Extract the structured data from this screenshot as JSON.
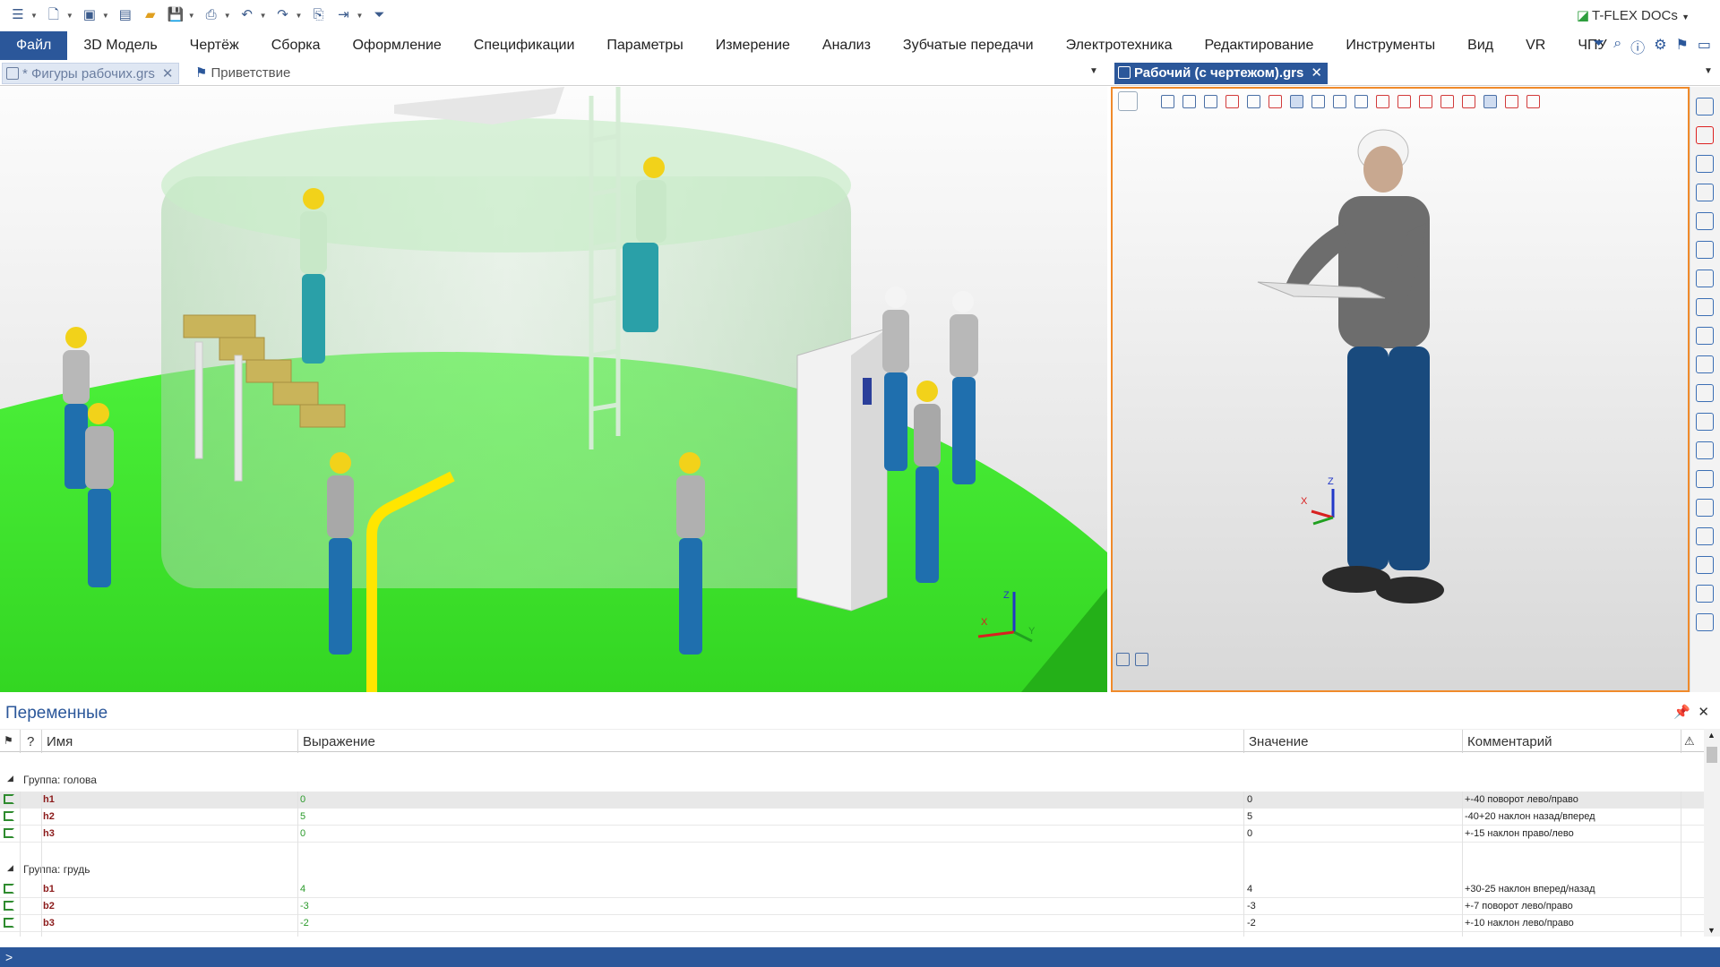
{
  "brand": "T-FLEX DOCs",
  "menu": {
    "file": "Файл",
    "items": [
      "3D Модель",
      "Чертёж",
      "Сборка",
      "Оформление",
      "Спецификации",
      "Параметры",
      "Измерение",
      "Анализ",
      "Зубчатые передачи",
      "Электротехника",
      "Редактирование",
      "Инструменты",
      "Вид",
      "VR",
      "ЧПУ"
    ]
  },
  "tabs": {
    "left_active": "* Фигуры рабочих.grs",
    "left_welcome": "Приветствие",
    "right_active": "Рабочий (с чертежом).grs"
  },
  "axes": {
    "x": "X",
    "y": "Y",
    "z": "Z"
  },
  "panel": {
    "title": "Переменные",
    "headers": {
      "flag": "",
      "q": "?",
      "name": "Имя",
      "expr": "Выражение",
      "value": "Значение",
      "comment": "Комментарий"
    },
    "groups": [
      {
        "label": "Группа: голова",
        "rows": [
          {
            "name": "h1",
            "expr": "0",
            "value": "0",
            "comment": "+-40 поворот лево/право"
          },
          {
            "name": "h2",
            "expr": "5",
            "value": "5",
            "comment": "-40+20 наклон назад/вперед"
          },
          {
            "name": "h3",
            "expr": "0",
            "value": "0",
            "comment": "+-15 наклон право/лево"
          }
        ]
      },
      {
        "label": "Группа: грудь",
        "rows": [
          {
            "name": "b1",
            "expr": "4",
            "value": "4",
            "comment": "+30-25 наклон вперед/назад"
          },
          {
            "name": "b2",
            "expr": "-3",
            "value": "-3",
            "comment": "+-7 поворот лево/право"
          },
          {
            "name": "b3",
            "expr": "-2",
            "value": "-2",
            "comment": "+-10 наклон лево/право"
          }
        ]
      }
    ]
  },
  "status": {
    "prompt": ">"
  },
  "colors": {
    "accent": "#2b579a",
    "floor": "#3ee32a",
    "tank": "#bfe6bf",
    "helmet": "#f2d21a",
    "pipe": "#ffe600",
    "active_border": "#f08a2a"
  }
}
